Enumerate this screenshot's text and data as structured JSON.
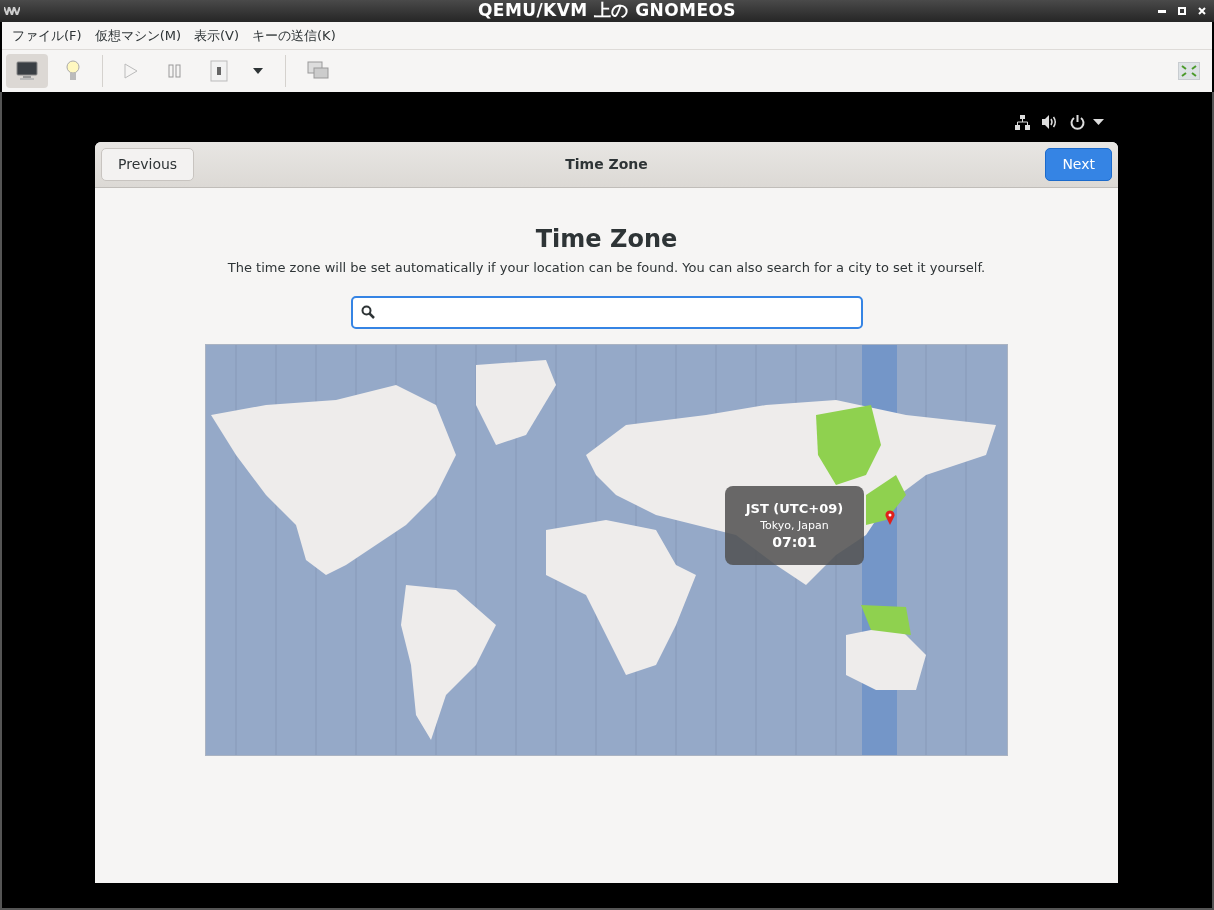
{
  "window": {
    "title": "QEMU/KVM 上の GNOMEOS"
  },
  "menu": [
    "ファイル(F)",
    "仮想マシン(M)",
    "表示(V)",
    "キーの送信(K)"
  ],
  "toolbar": {
    "console_selected": true
  },
  "dialog": {
    "title": "Time Zone",
    "previous": "Previous",
    "next": "Next",
    "heading": "Time Zone",
    "description": "The time zone will be set automatically if your location can be found. You can also search for a city to set it yourself.",
    "tooltip": {
      "zone": "JST (UTC+09)",
      "city": "Tokyo, Japan",
      "time": "07:01"
    }
  }
}
